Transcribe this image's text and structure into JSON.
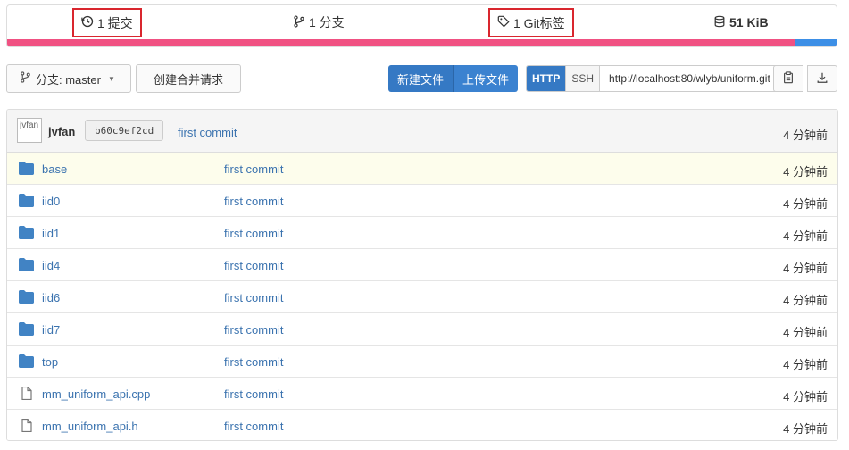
{
  "stats": {
    "commits": "1 提交",
    "branches": "1 分支",
    "tags": "1 Git标签",
    "size": "51 KiB"
  },
  "colors": {
    "lang_primary": "#f05182",
    "lang_secondary": "#3d8fe6",
    "primary_button": "#3579c4",
    "link": "#3b73af",
    "highlight_border": "#d9262e"
  },
  "toolbar": {
    "branch_label": "分支: master",
    "new_pr_label": "创建合并请求",
    "new_file_label": "新建文件",
    "upload_label": "上传文件",
    "http_label": "HTTP",
    "ssh_label": "SSH",
    "clone_url": "http://localhost:80/wlyb/uniform.git"
  },
  "latest_commit": {
    "avatar_alt": "jvfan",
    "author": "jvfan",
    "sha": "b60c9ef2cd",
    "message": "first commit",
    "time": "4 分钟前"
  },
  "files": [
    {
      "name": "base",
      "type": "folder",
      "message": "first commit",
      "time": "4 分钟前"
    },
    {
      "name": "iid0",
      "type": "folder",
      "message": "first commit",
      "time": "4 分钟前"
    },
    {
      "name": "iid1",
      "type": "folder",
      "message": "first commit",
      "time": "4 分钟前"
    },
    {
      "name": "iid4",
      "type": "folder",
      "message": "first commit",
      "time": "4 分钟前"
    },
    {
      "name": "iid6",
      "type": "folder",
      "message": "first commit",
      "time": "4 分钟前"
    },
    {
      "name": "iid7",
      "type": "folder",
      "message": "first commit",
      "time": "4 分钟前"
    },
    {
      "name": "top",
      "type": "folder",
      "message": "first commit",
      "time": "4 分钟前"
    },
    {
      "name": "mm_uniform_api.cpp",
      "type": "file",
      "message": "first commit",
      "time": "4 分钟前"
    },
    {
      "name": "mm_uniform_api.h",
      "type": "file",
      "message": "first commit",
      "time": "4 分钟前"
    }
  ]
}
